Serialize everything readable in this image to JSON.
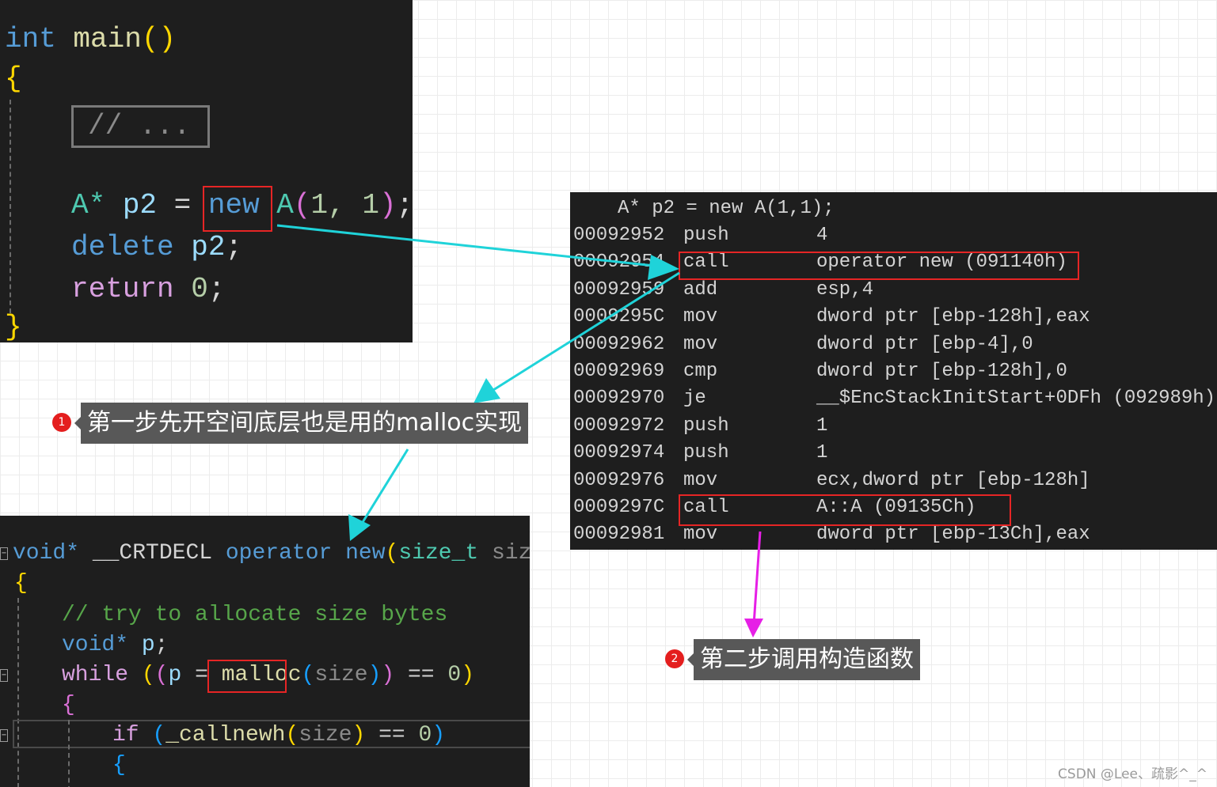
{
  "top_code": {
    "int": "int",
    "main": "main",
    "lparen": "(",
    "rparen": ")",
    "open_brace": "{",
    "close_brace": "}",
    "comment_placeholder": "// ...",
    "line_new": {
      "type": "A*",
      "var": "p2",
      "eq": "=",
      "kw": "new",
      "cls": "A",
      "open": "(",
      "args": "1, 1",
      "close": ")",
      "semi": ";"
    },
    "line_delete": {
      "kw": "delete",
      "var": "p2",
      "semi": ";"
    },
    "line_return": {
      "kw": "return",
      "val": "0",
      "semi": ";"
    }
  },
  "disasm": {
    "header": "A* p2 = new A(1,1);",
    "rows": [
      {
        "addr": "00092952",
        "mnemonic": "push",
        "operand": "4"
      },
      {
        "addr": "00092954",
        "mnemonic": "call",
        "operand": "operator new (091140h)"
      },
      {
        "addr": "00092959",
        "mnemonic": "add",
        "operand": "esp,4"
      },
      {
        "addr": "0009295C",
        "mnemonic": "mov",
        "operand": "dword ptr [ebp-128h],eax"
      },
      {
        "addr": "00092962",
        "mnemonic": "mov",
        "operand": "dword ptr [ebp-4],0"
      },
      {
        "addr": "00092969",
        "mnemonic": "cmp",
        "operand": "dword ptr [ebp-128h],0"
      },
      {
        "addr": "00092970",
        "mnemonic": "je",
        "operand": "__$EncStackInitStart+0DFh (092989h)"
      },
      {
        "addr": "00092972",
        "mnemonic": "push",
        "operand": "1"
      },
      {
        "addr": "00092974",
        "mnemonic": "push",
        "operand": "1"
      },
      {
        "addr": "00092976",
        "mnemonic": "mov",
        "operand": "ecx,dword ptr [ebp-128h]"
      },
      {
        "addr": "0009297C",
        "mnemonic": "call",
        "operand": "A::A (09135Ch)"
      },
      {
        "addr": "00092981",
        "mnemonic": "mov",
        "operand": "dword ptr [ebp-13Ch],eax"
      }
    ]
  },
  "bottom_code": {
    "sig": {
      "void": "void*",
      "crtdecl": "__CRTDECL",
      "op": "operator",
      "new": "new",
      "open": "(",
      "type": "size_t",
      "param": "size",
      "close": ")"
    },
    "open_brace": "{",
    "comment": "// try to allocate size bytes",
    "decl": {
      "type": "void*",
      "var": "p",
      "semi": ";"
    },
    "while_line": {
      "kw": "while",
      "p1": "(",
      "p2": "(",
      "var": "p",
      "eq": "=",
      "fn": "malloc",
      "p3": "(",
      "arg": "size",
      "p4": ")",
      "p5": ")",
      "cmp": "==",
      "zero": "0",
      "p6": ")"
    },
    "inner_open": "{",
    "if_line": {
      "kw": "if",
      "p1": "(",
      "fn": "_callnewh",
      "p2": "(",
      "arg": "size",
      "p3": ")",
      "cmp": "==",
      "zero": "0",
      "p4": ")"
    },
    "if_open": "{"
  },
  "callouts": {
    "step1": {
      "badge": "1",
      "text": "第一步先开空间底层也是用的malloc实现"
    },
    "step2": {
      "badge": "2",
      "text": "第二步调用构造函数"
    }
  },
  "watermark": "CSDN @Lee、疏影^_^",
  "colors": {
    "arrow_cyan": "#1fd3d9",
    "arrow_magenta": "#e61fe6",
    "highlight_red": "#e62525"
  }
}
